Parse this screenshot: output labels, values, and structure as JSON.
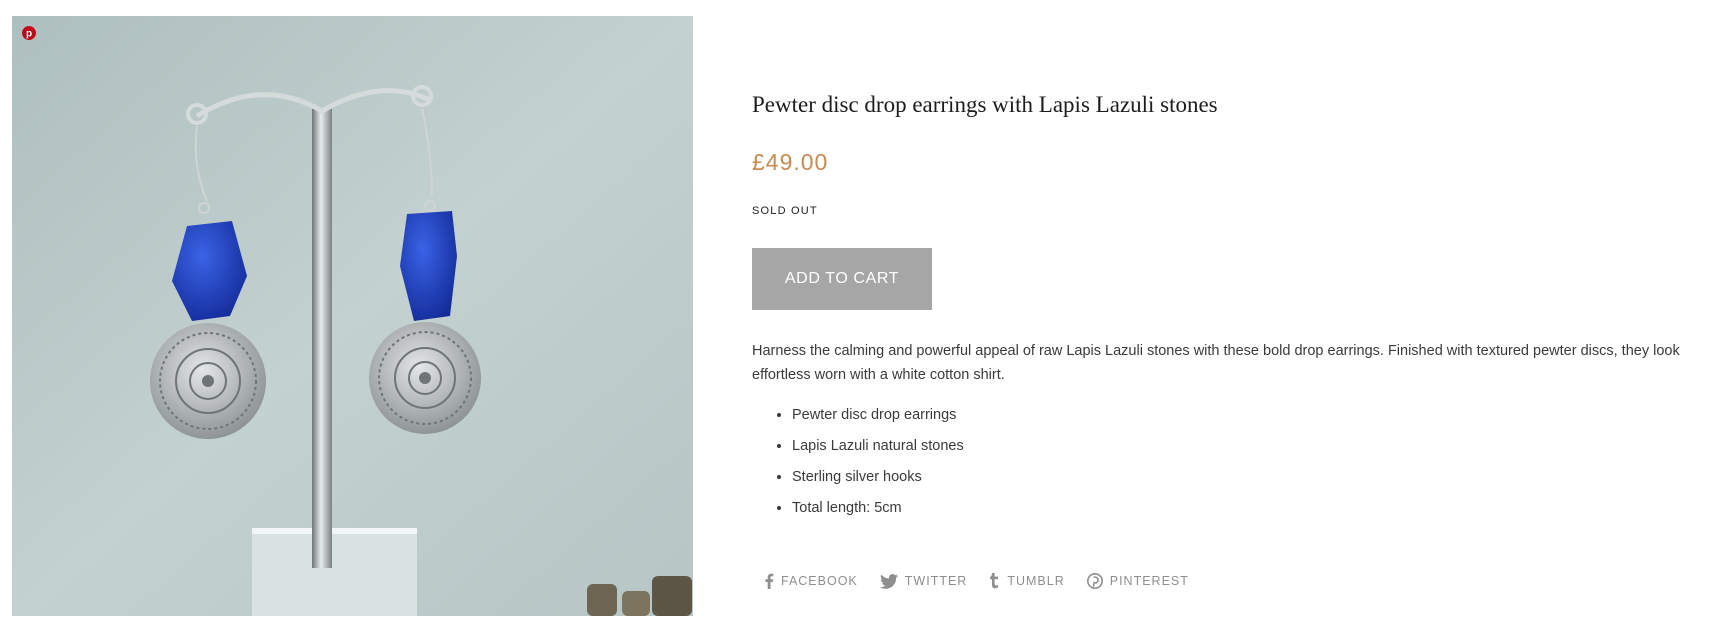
{
  "product": {
    "title": "Pewter disc drop earrings with Lapis Lazuli stones",
    "price": "£49.00",
    "availability": "SOLD OUT",
    "add_to_cart_label": "ADD TO CART",
    "description": "Harness the calming and powerful appeal of raw Lapis Lazuli stones with these bold drop earrings. Finished with textured pewter discs, they look effortless worn with a white cotton shirt.",
    "features": [
      "Pewter disc drop earrings",
      "Lapis Lazuli natural stones",
      "Sterling silver hooks",
      "Total length: 5cm"
    ]
  },
  "image": {
    "pin_icon": "pinterest-icon"
  },
  "social": [
    {
      "label": "FACEBOOK",
      "icon": "facebook-icon"
    },
    {
      "label": "TWITTER",
      "icon": "twitter-icon"
    },
    {
      "label": "TUMBLR",
      "icon": "tumblr-icon"
    },
    {
      "label": "PINTEREST",
      "icon": "pinterest-icon"
    }
  ],
  "colors": {
    "price": "#c68b50",
    "button": "#a6a6a6",
    "social": "#8e8e8e",
    "pinterest_red": "#bd081c",
    "lapis": "#1f3fb8"
  }
}
